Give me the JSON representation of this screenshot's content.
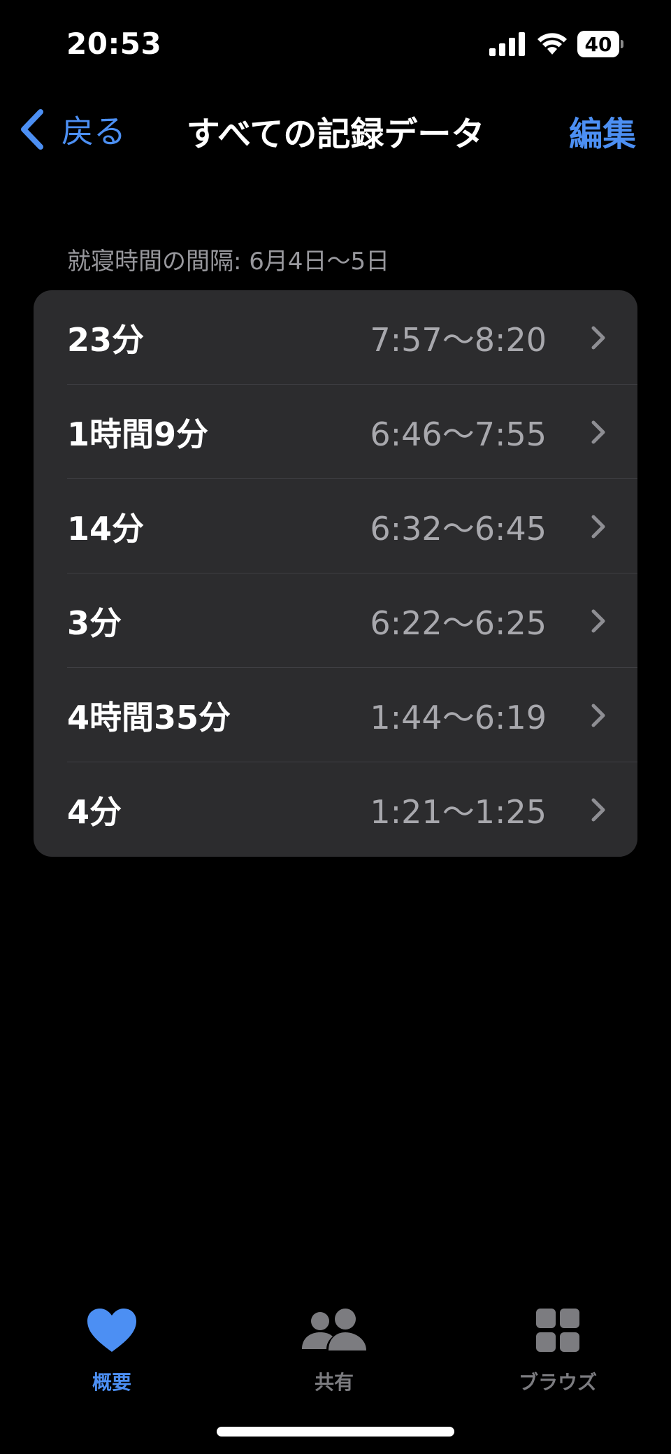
{
  "status_bar": {
    "time": "20:53",
    "battery": "40",
    "icons": [
      "cellular-signal-icon",
      "wifi-icon",
      "battery-icon"
    ]
  },
  "nav": {
    "back_label": "戻る",
    "title": "すべての記録データ",
    "edit_label": "編集"
  },
  "section": {
    "header": "就寝時間の間隔: 6月4日〜5日"
  },
  "rows": [
    {
      "duration": "23分",
      "range": "7:57〜8:20"
    },
    {
      "duration": "1時間9分",
      "range": "6:46〜7:55"
    },
    {
      "duration": "14分",
      "range": "6:32〜6:45"
    },
    {
      "duration": "3分",
      "range": "6:22〜6:25"
    },
    {
      "duration": "4時間35分",
      "range": "1:44〜6:19"
    },
    {
      "duration": "4分",
      "range": "1:21〜1:25"
    }
  ],
  "tab_bar": {
    "tabs": [
      {
        "label": "概要",
        "icon": "heart-icon",
        "selected": true
      },
      {
        "label": "共有",
        "icon": "people-icon",
        "selected": false
      },
      {
        "label": "ブラウズ",
        "icon": "grid-icon",
        "selected": false
      }
    ]
  },
  "colors": {
    "accent": "#4c8ff3",
    "background": "#000000",
    "card": "#2c2c2e",
    "secondary_text": "#98989d"
  }
}
